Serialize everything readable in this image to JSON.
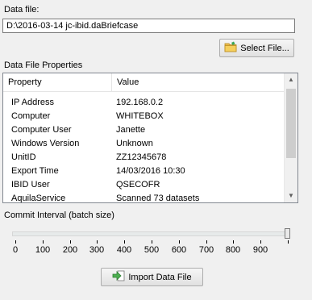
{
  "data_file": {
    "label": "Data file:",
    "value": "D:\\2016-03-14 jc-ibid.daBriefcase",
    "select_button": "Select File..."
  },
  "properties": {
    "label": "Data File Properties",
    "columns": [
      "Property",
      "Value"
    ],
    "rows": [
      {
        "property": "IP Address",
        "value": "192.168.0.2"
      },
      {
        "property": "Computer",
        "value": "WHITEBOX"
      },
      {
        "property": "Computer User",
        "value": "Janette"
      },
      {
        "property": "Windows Version",
        "value": "Unknown"
      },
      {
        "property": "UnitID",
        "value": "ZZ12345678"
      },
      {
        "property": "Export Time",
        "value": "14/03/2016 10:30"
      },
      {
        "property": "IBID User",
        "value": "QSECOFR"
      },
      {
        "property": "AquilaService",
        "value": "Scanned 73 datasets"
      }
    ]
  },
  "commit": {
    "label": "Commit Interval (batch size)",
    "value": 1000,
    "min": 0,
    "max": 1000,
    "ticks": [
      "0",
      "100",
      "200",
      "300",
      "400",
      "500",
      "600",
      "700",
      "800",
      "900",
      ""
    ]
  },
  "import_button": "Import Data File"
}
